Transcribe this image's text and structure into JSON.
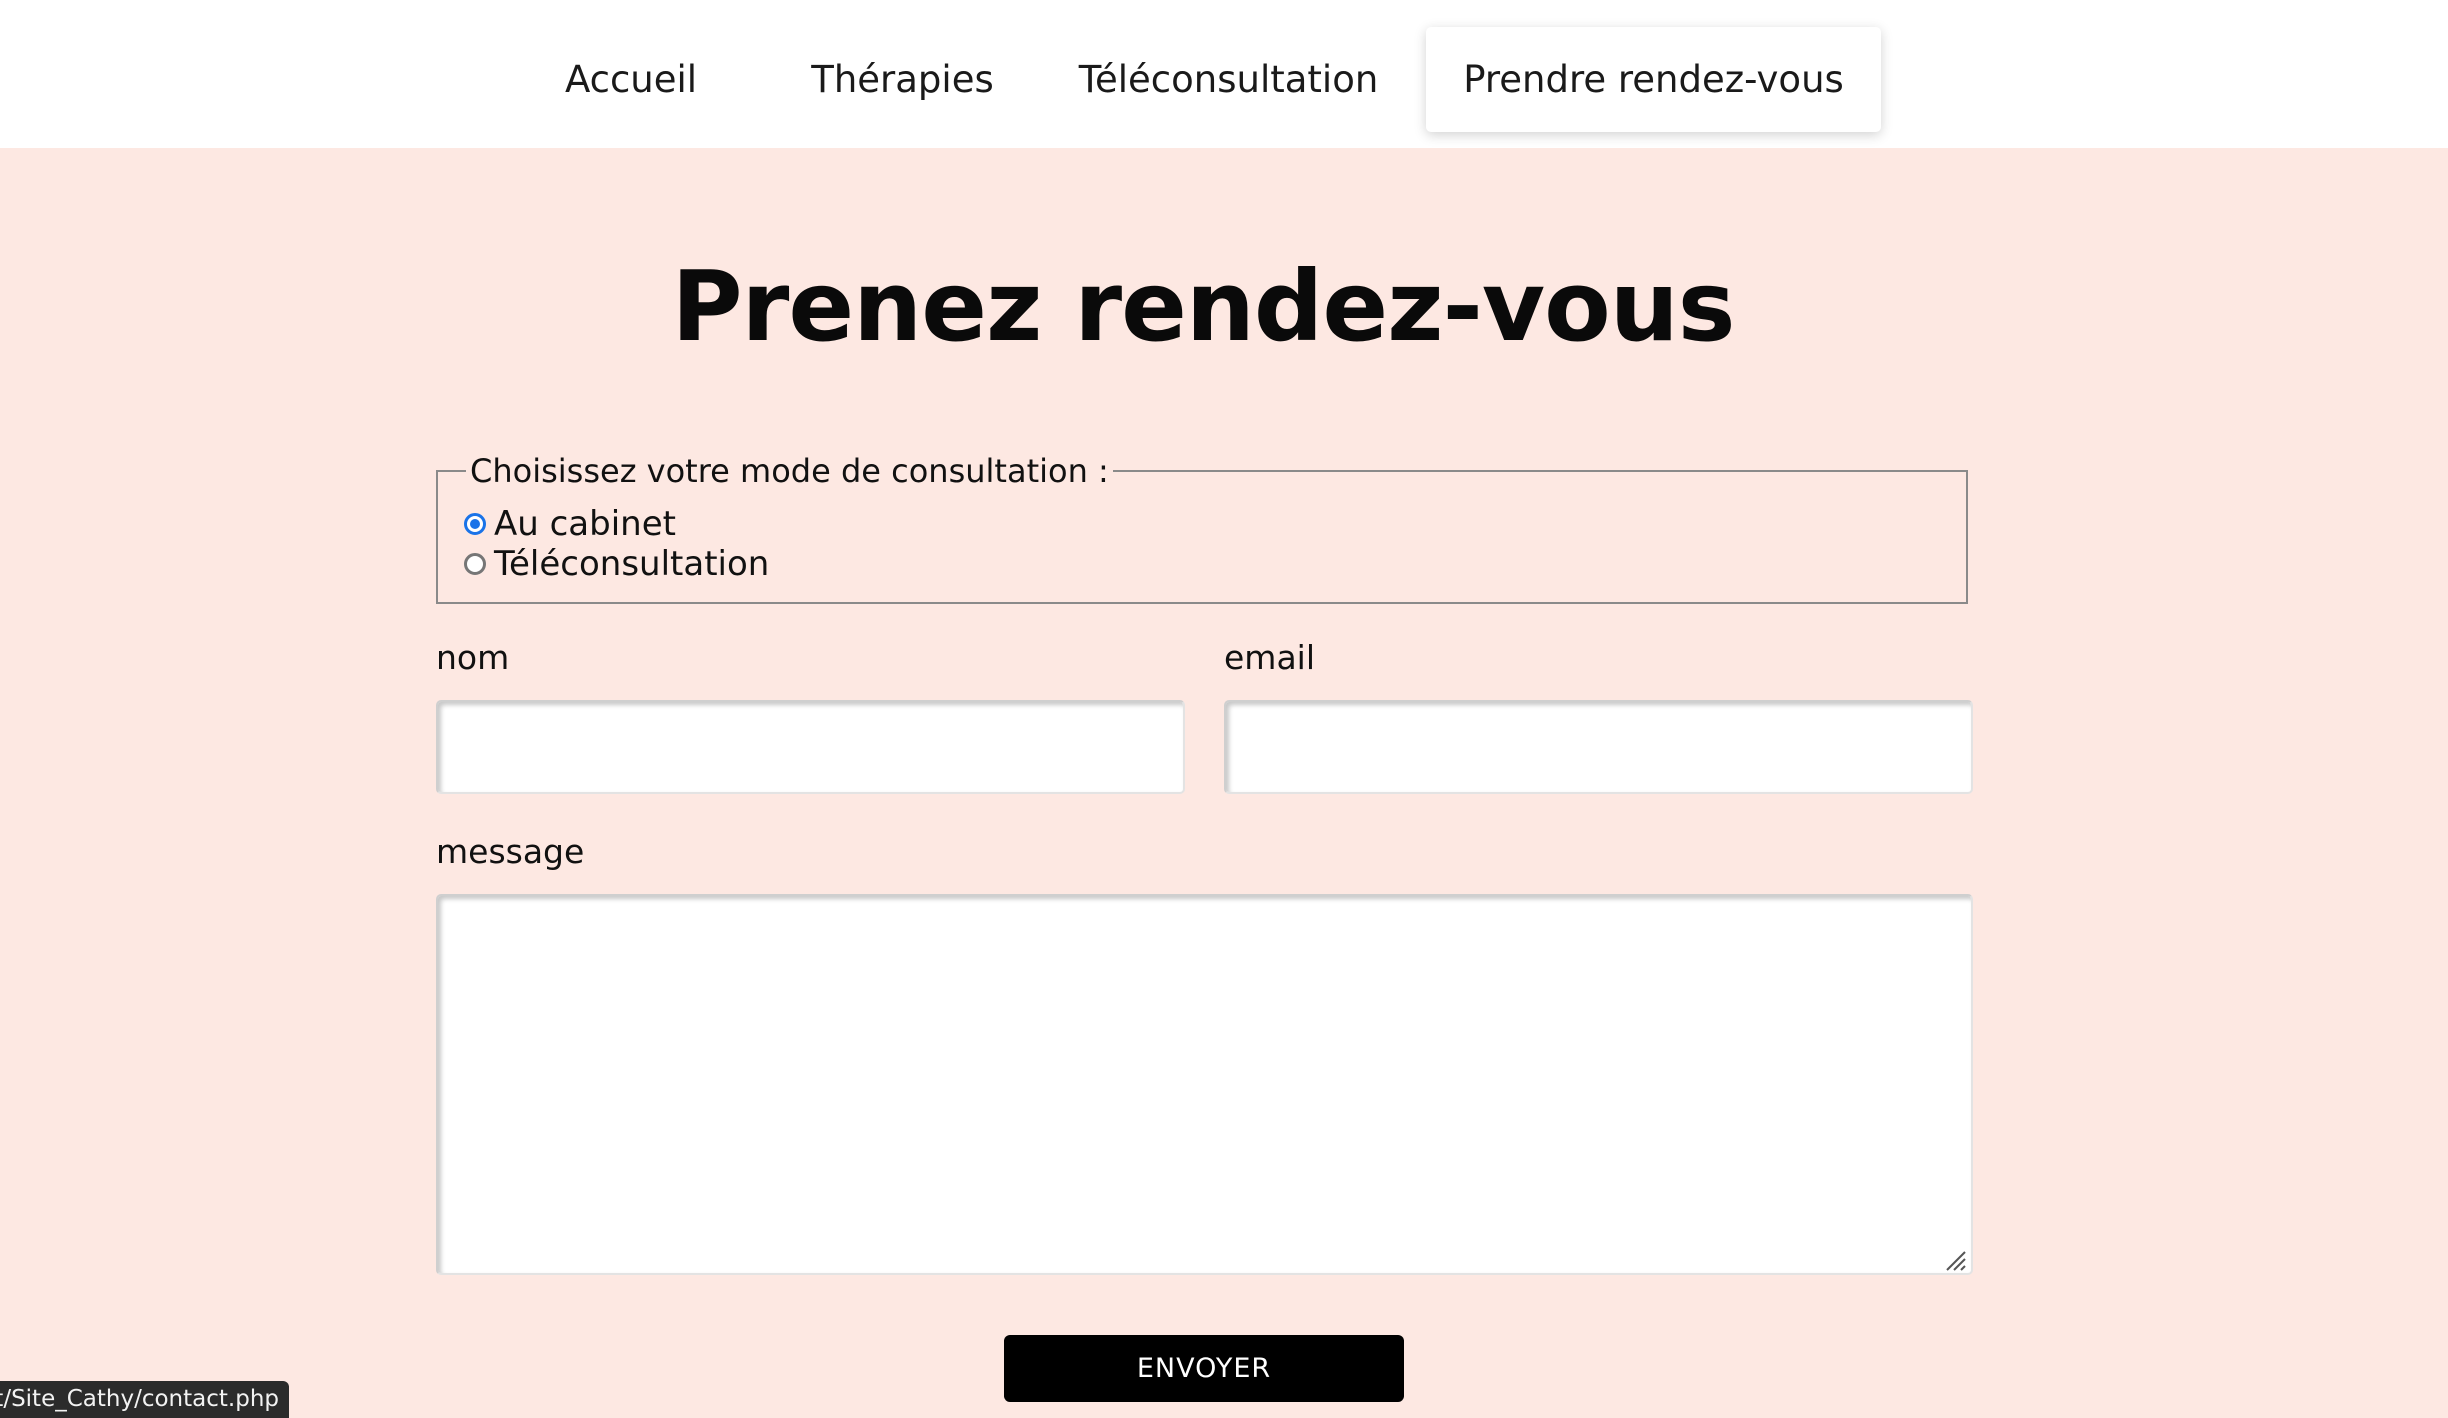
{
  "nav": {
    "items": [
      {
        "label": "Accueil",
        "active": false
      },
      {
        "label": "Thérapies",
        "active": false
      },
      {
        "label": "Téléconsultation",
        "active": false
      },
      {
        "label": "Prendre rendez-vous",
        "active": true
      }
    ]
  },
  "page": {
    "title": "Prenez rendez-vous",
    "background_color": "#fde8e2"
  },
  "form": {
    "consultation": {
      "legend": "Choisissez votre mode de consultation :",
      "options": [
        {
          "label": "Au cabinet",
          "checked": true
        },
        {
          "label": "Téléconsultation",
          "checked": false
        }
      ]
    },
    "nom": {
      "label": "nom",
      "value": ""
    },
    "email": {
      "label": "email",
      "value": ""
    },
    "message": {
      "label": "message",
      "value": ""
    },
    "submit_label": "ENVOYER"
  },
  "status_bar": {
    "url_text": "ost/Site_Cathy/contact.php"
  },
  "colors": {
    "accent": "#1a73e8",
    "button": "#000000"
  }
}
